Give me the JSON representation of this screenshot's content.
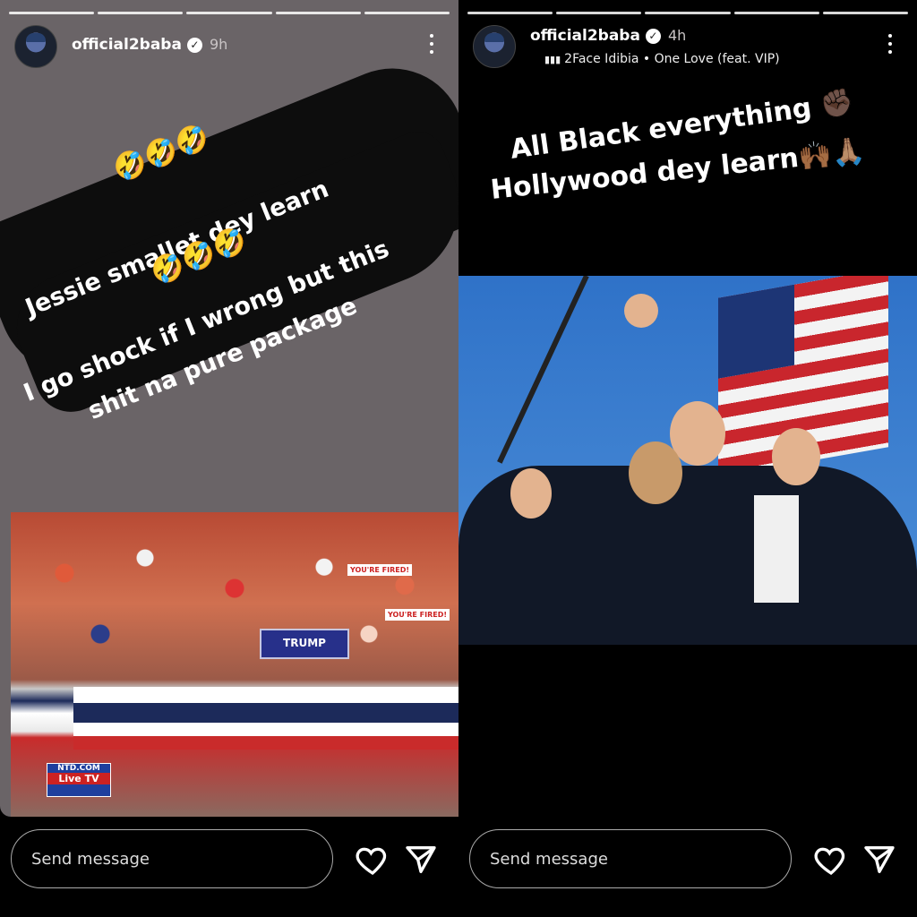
{
  "left_story": {
    "username": "official2baba",
    "time": "9h",
    "caption_lines": [
      "Jessie smallet dey learn",
      "I go shock if I wrong but this",
      "shit na pure package"
    ],
    "emoji_row1": "🤣🤣🤣",
    "emoji_row2": "🤣🤣🤣",
    "image": {
      "podium_text": "TRUMP",
      "sign_text": "YOU'RE FIRED!",
      "ntd_top": "NTD.COM",
      "ntd_bottom": "Live TV"
    },
    "message_placeholder": "Send message"
  },
  "right_story": {
    "username": "official2baba",
    "time": "4h",
    "music": "2Face Idibia • One Love (feat. VIP)",
    "caption_line1": "All Black everything",
    "caption_line2": "Hollywood dey learn",
    "emoji1": "✊🏿",
    "emoji2": "🙌🏾🙏🏽",
    "message_placeholder": "Send message"
  },
  "icons": [
    "heart-icon",
    "send-icon",
    "more-options-icon",
    "verified-badge-icon",
    "music-bars-icon"
  ],
  "colors": {
    "left_bg": "#6a6467",
    "right_bg": "#000000"
  }
}
